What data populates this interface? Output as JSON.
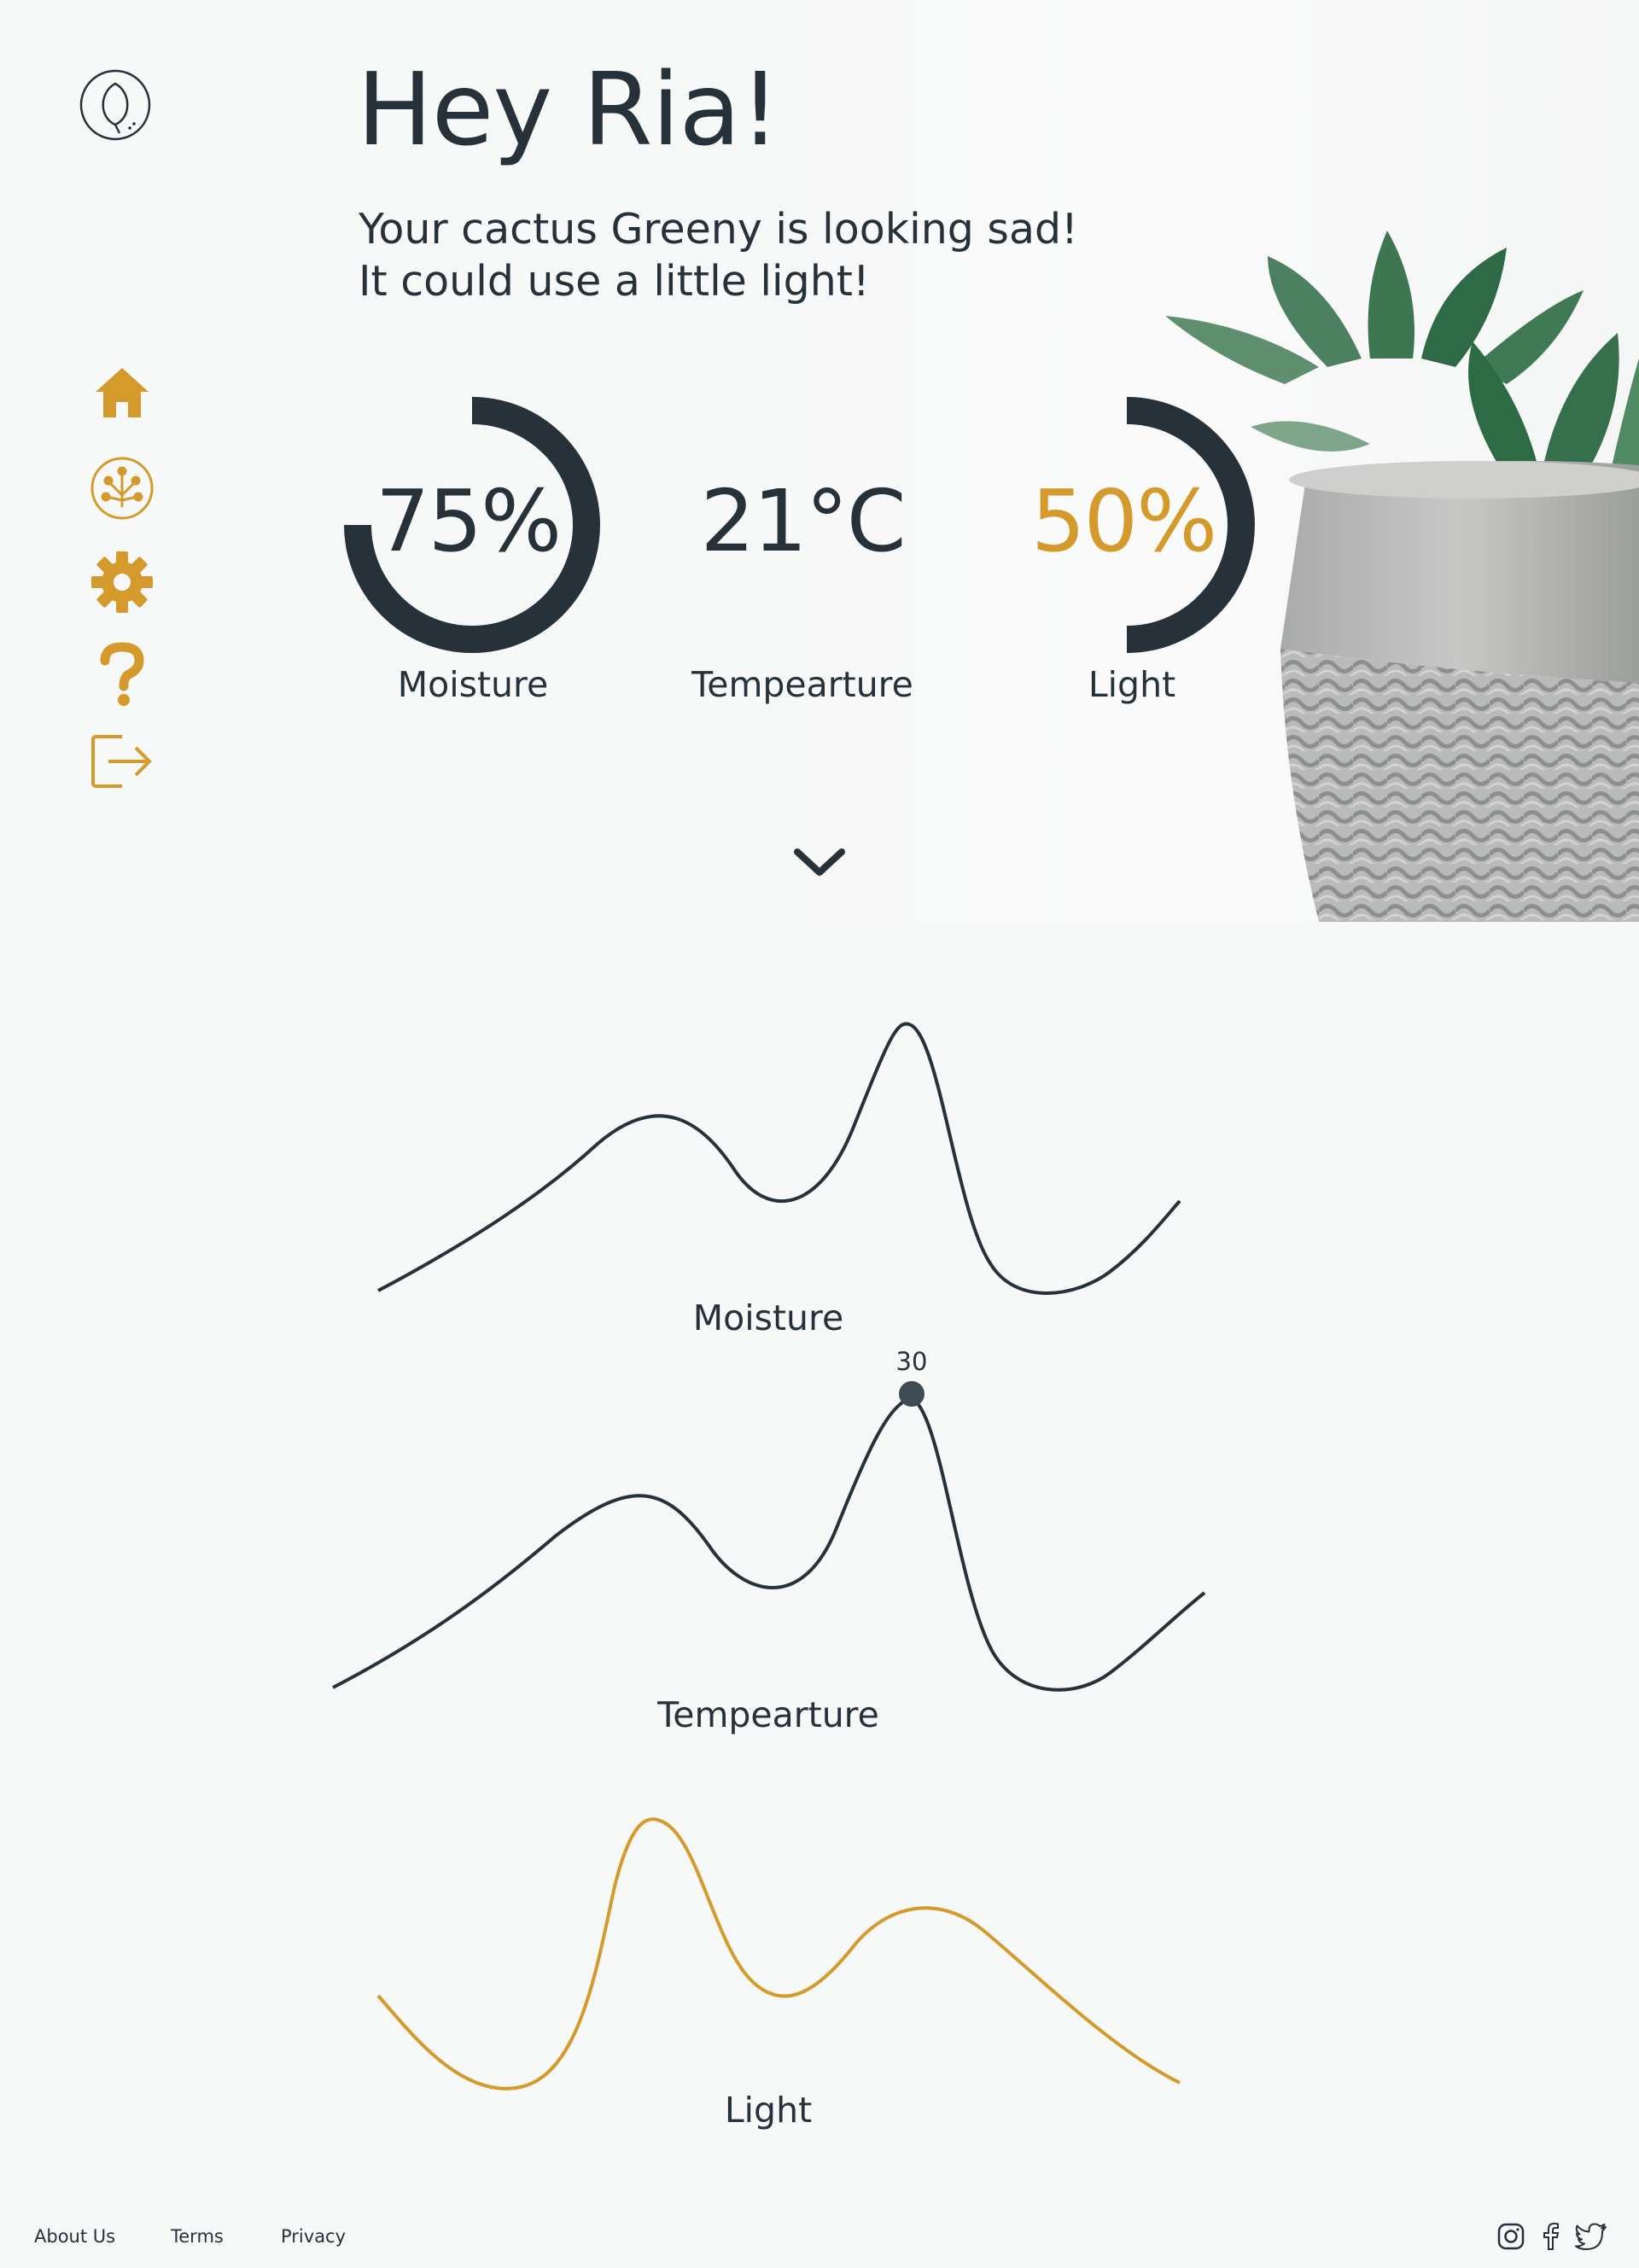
{
  "app": {
    "logo_icon": "leaf-logo-icon"
  },
  "colors": {
    "accent": "#d49a2c",
    "ink": "#26313a",
    "background": "#f7f8f8"
  },
  "sidebar": {
    "items": [
      {
        "icon": "home-icon",
        "active": true
      },
      {
        "icon": "plant-network-icon",
        "active": false
      },
      {
        "icon": "gear-icon",
        "active": false
      },
      {
        "icon": "question-icon",
        "active": false
      },
      {
        "icon": "logout-icon",
        "active": false
      }
    ]
  },
  "header": {
    "greeting": "Hey Ria!",
    "message_line1": "Your cactus Greeny is looking sad!",
    "message_line2": "It could use a little light!"
  },
  "stats": [
    {
      "value": "75%",
      "label": "Moisture",
      "percent": 75
    },
    {
      "value": "21°C",
      "label": "Tempearture"
    },
    {
      "value": "50%",
      "label": "Light",
      "percent": 50
    }
  ],
  "scroll_icon": "chevron-down-icon",
  "charts": {
    "moisture": {
      "label": "Moisture"
    },
    "temperature": {
      "label": "Tempearture",
      "tooltip_value": "30"
    },
    "light": {
      "label": "Light"
    }
  },
  "footer": {
    "links": [
      "About Us",
      "Terms",
      "Privacy"
    ],
    "social": [
      "instagram-icon",
      "facebook-icon",
      "twitter-icon"
    ]
  }
}
